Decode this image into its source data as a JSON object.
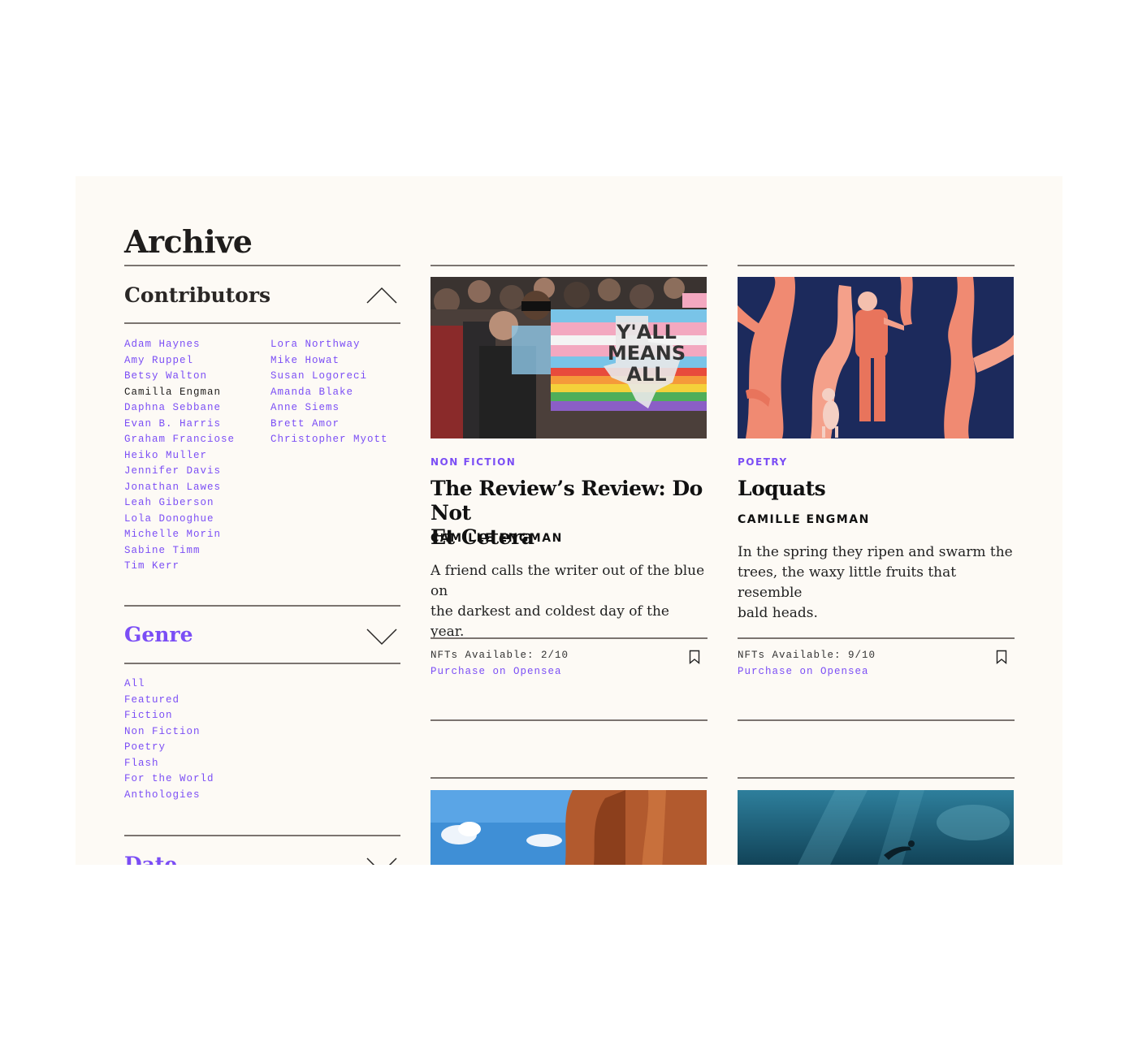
{
  "page": {
    "title": "Archive"
  },
  "sidebar": {
    "contributors": {
      "title": "Contributors",
      "col1": [
        "Adam Haynes",
        "Amy Ruppel",
        "Betsy Walton",
        "Camilla Engman",
        "Daphna Sebbane",
        "Evan B. Harris",
        "Graham Franciose",
        "Heiko Muller",
        "Jennifer Davis",
        "Jonathan Lawes",
        "Leah Giberson",
        "Lola Donoghue",
        "Michelle Morin",
        "Sabine Timm",
        "Tim Kerr"
      ],
      "col2": [
        "Lora Northway",
        "Mike Howat",
        "Susan Logoreci",
        "Amanda Blake",
        "Anne Siems",
        "Brett Amor",
        "Christopher Myott"
      ],
      "active": "Camilla Engman"
    },
    "genre": {
      "title": "Genre",
      "items": [
        "All",
        "Featured",
        "Fiction",
        "Non Fiction",
        "Poetry",
        "Flash",
        "For the World",
        "Anthologies"
      ]
    },
    "date": {
      "title": "Date"
    }
  },
  "cards": [
    {
      "genre": "NON FICTION",
      "title_line1": "The Review’s Review: Do Not",
      "title_line2": "Et Cetera",
      "author": "CAMILLE ENGMAN",
      "blurb_line1": "A friend calls the writer out of the blue on",
      "blurb_line2": "the darkest and coldest day of the year.",
      "nft": "NFTs Available: 2/10",
      "purchase": "Purchase on Opensea",
      "sign_text": [
        "Y'ALL",
        "MEANS",
        "ALL"
      ]
    },
    {
      "genre": "POETRY",
      "title": "Loquats",
      "author": "CAMILLE ENGMAN",
      "blurb_line1": "In the spring they ripen and swarm the",
      "blurb_line2": "trees, the waxy little fruits that resemble",
      "blurb_line3": "bald heads.",
      "nft": "NFTs Available: 9/10",
      "purchase": "Purchase on Opensea"
    }
  ],
  "colors": {
    "accent": "#7b4ef5",
    "background": "#fdfaf5",
    "rule": "#7b7470"
  }
}
